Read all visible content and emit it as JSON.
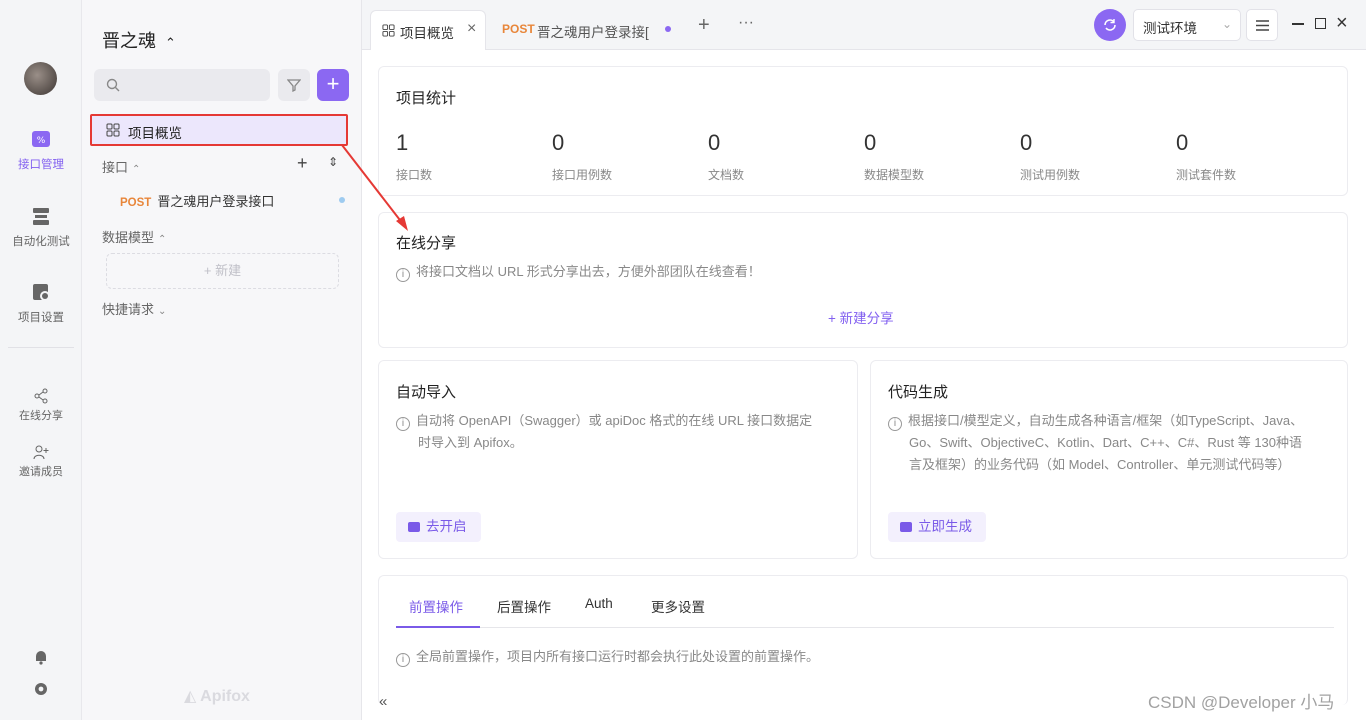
{
  "rail": {
    "items": [
      {
        "label": "接口管理",
        "icon": "api-management-icon",
        "active": true
      },
      {
        "label": "自动化测试",
        "icon": "automation-test-icon",
        "active": false
      },
      {
        "label": "项目设置",
        "icon": "project-settings-icon",
        "active": false
      }
    ],
    "small": [
      {
        "label": "在线分享",
        "icon": "share-icon"
      },
      {
        "label": "邀请成员",
        "icon": "invite-member-icon"
      }
    ]
  },
  "sidebar": {
    "project_name": "晋之魂",
    "overview_label": "项目概览",
    "sections": {
      "api": "接口",
      "models": "数据模型",
      "quick": "快捷请求"
    },
    "api_item": {
      "method": "POST",
      "name": "晋之魂用户登录接口"
    },
    "new_label": "+ 新建",
    "brand": "Apifox"
  },
  "tabs": [
    {
      "label": "项目概览",
      "active": true
    },
    {
      "label": "晋之魂用户登录接[",
      "method": "POST",
      "active": false
    }
  ],
  "env": {
    "selected": "测试环境"
  },
  "stats": {
    "title": "项目统计",
    "items": [
      {
        "value": "1",
        "label": "接口数"
      },
      {
        "value": "0",
        "label": "接口用例数"
      },
      {
        "value": "0",
        "label": "文档数"
      },
      {
        "value": "0",
        "label": "数据模型数"
      },
      {
        "value": "0",
        "label": "测试用例数"
      },
      {
        "value": "0",
        "label": "测试套件数"
      }
    ]
  },
  "share": {
    "title": "在线分享",
    "hint": "将接口文档以 URL 形式分享出去，方便外部团队在线查看！",
    "new_label": "+ 新建分享"
  },
  "auto_import": {
    "title": "自动导入",
    "hint_line1": "自动将 OpenAPI（Swagger）或 apiDoc 格式的在线 URL 接口数据定",
    "hint_line2": "时导入到 Apifox。",
    "button": "去开启"
  },
  "codegen": {
    "title": "代码生成",
    "hint_line1": "根据接口/模型定义，自动生成各种语言/框架（如TypeScript、Java、",
    "hint_line2": "Go、Swift、ObjectiveC、Kotlin、Dart、C++、C#、Rust 等 130种语",
    "hint_line3": "言及框架）的业务代码（如 Model、Controller、单元测试代码等）",
    "button": "立即生成"
  },
  "settings_tabs": {
    "items": [
      "前置操作",
      "后置操作",
      "Auth",
      "更多设置"
    ],
    "hint": "全局前置操作，项目内所有接口运行时都会执行此处设置的前置操作。"
  },
  "footer": {
    "collapse": "«",
    "watermark": "CSDN @Developer 小马"
  },
  "colors": {
    "accent": "#8b68f2",
    "post": "#e8863a",
    "highlight": "#e53935"
  }
}
